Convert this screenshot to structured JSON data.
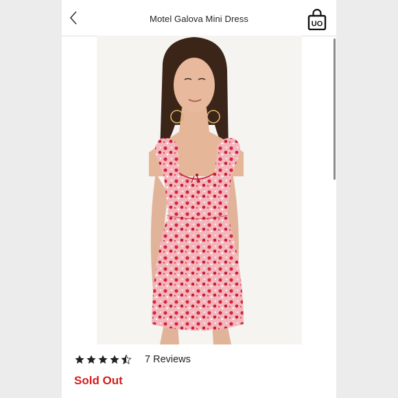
{
  "header": {
    "title": "Motel Galova Mini Dress",
    "back_icon": "chevron-left-icon",
    "bag_icon": "shopping-bag-icon",
    "bag_logo": "UO"
  },
  "product": {
    "image": "product-photo",
    "rating": 4.5,
    "rating_max": 5,
    "reviews_label": "7 Reviews",
    "status": "Sold Out"
  },
  "colors": {
    "status_red": "#d21f1f",
    "text": "#222222",
    "dress_red": "#d2283a",
    "dress_pink": "#f4b6bd"
  }
}
